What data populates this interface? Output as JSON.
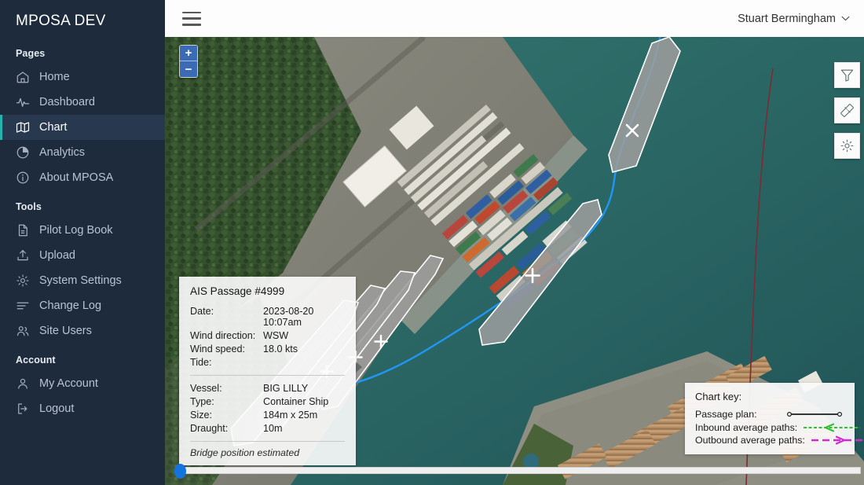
{
  "brand": "MPOSA DEV",
  "topbar": {
    "menu_icon": "hamburger-icon",
    "user_name": "Stuart Bermingham",
    "chevron_icon": "chevron-down-icon"
  },
  "sidebar": {
    "sections": [
      {
        "label": "Pages",
        "items": [
          {
            "label": "Home",
            "icon": "home-icon",
            "active": false
          },
          {
            "label": "Dashboard",
            "icon": "activity-icon",
            "active": false
          },
          {
            "label": "Chart",
            "icon": "map-icon",
            "active": true
          },
          {
            "label": "Analytics",
            "icon": "pie-chart-icon",
            "active": false
          },
          {
            "label": "About MPOSA",
            "icon": "info-circle-icon",
            "active": false
          }
        ]
      },
      {
        "label": "Tools",
        "items": [
          {
            "label": "Pilot Log Book",
            "icon": "document-icon",
            "active": false
          },
          {
            "label": "Upload",
            "icon": "upload-icon",
            "active": false
          },
          {
            "label": "System Settings",
            "icon": "gear-icon",
            "active": false
          },
          {
            "label": "Change Log",
            "icon": "list-lines-icon",
            "active": false
          },
          {
            "label": "Site Users",
            "icon": "users-icon",
            "active": false
          }
        ]
      },
      {
        "label": "Account",
        "items": [
          {
            "label": "My Account",
            "icon": "user-icon",
            "active": false
          },
          {
            "label": "Logout",
            "icon": "logout-icon",
            "active": false
          }
        ]
      }
    ]
  },
  "map": {
    "zoom_in_label": "+",
    "zoom_out_label": "−",
    "tools": [
      {
        "name": "filter-tool",
        "icon": "funnel-icon"
      },
      {
        "name": "measure-tool",
        "icon": "ruler-icon"
      },
      {
        "name": "map-settings-tool",
        "icon": "gear-icon"
      }
    ],
    "slider_position_pct": 0
  },
  "info_panel": {
    "title": "AIS Passage #4999",
    "rows_top": [
      {
        "key": "Date:",
        "value": "2023-08-20 10:07am"
      },
      {
        "key": "Wind direction:",
        "value": "WSW"
      },
      {
        "key": "Wind speed:",
        "value": "18.0 kts"
      },
      {
        "key": "Tide:",
        "value": ""
      }
    ],
    "rows_bottom": [
      {
        "key": "Vessel:",
        "value": "BIG LILLY"
      },
      {
        "key": "Type:",
        "value": "Container Ship"
      },
      {
        "key": "Size:",
        "value": "184m x 25m"
      },
      {
        "key": "Draught:",
        "value": "10m"
      }
    ],
    "footnote": "Bridge position estimated"
  },
  "chart_key": {
    "title": "Chart key:",
    "rows": [
      {
        "label": "Passage plan:",
        "symbol": "line-with-endpoints",
        "color": "#1c1c1c"
      },
      {
        "label": "Inbound average paths:",
        "symbol": "dashed-arrow-left",
        "color": "#2fc02f"
      },
      {
        "label": "Outbound average paths:",
        "symbol": "dashed-arrow-right",
        "color": "#d12ad1"
      }
    ]
  },
  "colors": {
    "sidebar_bg": "#1e2b3c",
    "sidebar_active_bg": "#27384f",
    "accent_teal": "#25b3b0",
    "water": "#2d6b68",
    "track_blue": "#2196f3",
    "vessel_fill": "#9d9d9d",
    "boundary_red": "#7b2b33"
  }
}
